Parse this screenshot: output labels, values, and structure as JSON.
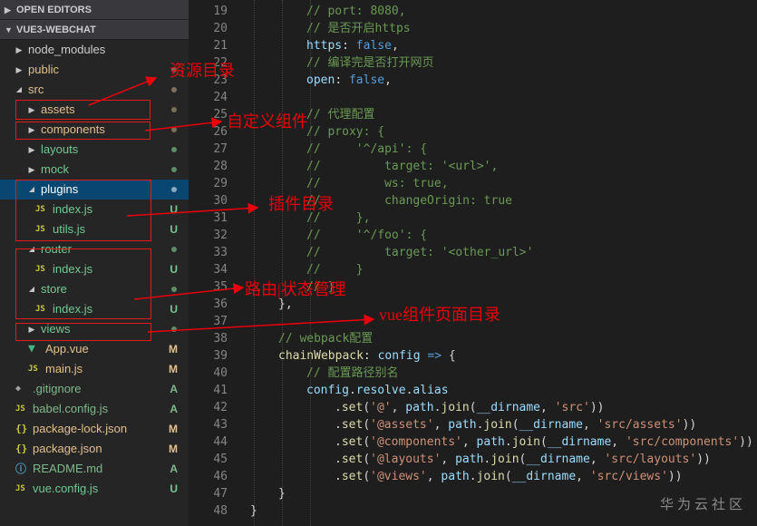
{
  "explorer": {
    "sections": {
      "open_editors": "OPEN EDITORS",
      "project": "VUE3-WEBCHAT"
    },
    "items": [
      {
        "label": "node_modules",
        "type": "folder",
        "state": "collapsed",
        "depth": 0,
        "badge": "",
        "label_color": "#cccccc"
      },
      {
        "label": "public",
        "type": "folder",
        "state": "collapsed",
        "depth": 0,
        "badge": "dot-mod",
        "label_color": "#e2c08d"
      },
      {
        "label": "src",
        "type": "folder",
        "state": "expanded",
        "depth": 0,
        "badge": "dot-mod",
        "label_color": "#e2c08d"
      },
      {
        "label": "assets",
        "type": "folder",
        "state": "collapsed",
        "depth": 1,
        "badge": "dot-mod",
        "label_color": "#e2c08d"
      },
      {
        "label": "components",
        "type": "folder",
        "state": "collapsed",
        "depth": 1,
        "badge": "dot-mod",
        "label_color": "#e2c08d"
      },
      {
        "label": "layouts",
        "type": "folder",
        "state": "collapsed",
        "depth": 1,
        "badge": "dot-unt",
        "label_color": "#73c991"
      },
      {
        "label": "mock",
        "type": "folder",
        "state": "collapsed",
        "depth": 1,
        "badge": "dot-unt",
        "label_color": "#73c991"
      },
      {
        "label": "plugins",
        "type": "folder",
        "state": "expanded",
        "depth": 1,
        "badge": "dot-sel",
        "label_color": "#ffffff",
        "selected": true
      },
      {
        "label": "index.js",
        "type": "js",
        "icon": "JS",
        "depth": 2,
        "badge": "U",
        "label_color": "#73c991"
      },
      {
        "label": "utils.js",
        "type": "js",
        "icon": "JS",
        "depth": 2,
        "badge": "U",
        "label_color": "#73c991"
      },
      {
        "label": "router",
        "type": "folder",
        "state": "expanded",
        "depth": 1,
        "badge": "dot-unt",
        "label_color": "#73c991"
      },
      {
        "label": "index.js",
        "type": "js",
        "icon": "JS",
        "depth": 2,
        "badge": "U",
        "label_color": "#73c991"
      },
      {
        "label": "store",
        "type": "folder",
        "state": "expanded",
        "depth": 1,
        "badge": "dot-unt",
        "label_color": "#73c991"
      },
      {
        "label": "index.js",
        "type": "js",
        "icon": "JS",
        "depth": 2,
        "badge": "U",
        "label_color": "#73c991"
      },
      {
        "label": "views",
        "type": "folder",
        "state": "collapsed",
        "depth": 1,
        "badge": "dot-unt",
        "label_color": "#73c991"
      },
      {
        "label": "App.vue",
        "type": "vue",
        "icon": "V",
        "depth": 1,
        "badge": "M",
        "label_color": "#e2c08d"
      },
      {
        "label": "main.js",
        "type": "js",
        "icon": "JS",
        "depth": 1,
        "badge": "M",
        "label_color": "#e2c08d"
      },
      {
        "label": ".gitignore",
        "type": "git",
        "icon": "◆",
        "depth": 0,
        "badge": "A",
        "label_color": "#81b88b"
      },
      {
        "label": "babel.config.js",
        "type": "js",
        "icon": "JS",
        "depth": 0,
        "badge": "A",
        "label_color": "#81b88b"
      },
      {
        "label": "package-lock.json",
        "type": "json",
        "icon": "{}",
        "depth": 0,
        "badge": "M",
        "label_color": "#e2c08d"
      },
      {
        "label": "package.json",
        "type": "json",
        "icon": "{}",
        "depth": 0,
        "badge": "M",
        "label_color": "#e2c08d"
      },
      {
        "label": "README.md",
        "type": "info",
        "icon": "ⓘ",
        "depth": 0,
        "badge": "A",
        "label_color": "#81b88b"
      },
      {
        "label": "vue.config.js",
        "type": "js",
        "icon": "JS",
        "depth": 0,
        "badge": "U",
        "label_color": "#73c991"
      }
    ]
  },
  "editor": {
    "lines": [
      {
        "n": "19",
        "tokens": [
          [
            "com",
            "// port: 8080,"
          ]
        ],
        "indent": 2
      },
      {
        "n": "20",
        "tokens": [
          [
            "com",
            "// 是否开启https"
          ]
        ],
        "indent": 2
      },
      {
        "n": "21",
        "tokens": [
          [
            "prop",
            "https"
          ],
          [
            "punc",
            ": "
          ],
          [
            "kw",
            "false"
          ],
          [
            "punc",
            ","
          ]
        ],
        "indent": 2
      },
      {
        "n": "22",
        "tokens": [
          [
            "com",
            "// 编译完是否打开网页"
          ]
        ],
        "indent": 2
      },
      {
        "n": "23",
        "tokens": [
          [
            "prop",
            "open"
          ],
          [
            "punc",
            ": "
          ],
          [
            "kw",
            "false"
          ],
          [
            "punc",
            ","
          ]
        ],
        "indent": 2
      },
      {
        "n": "24",
        "tokens": [],
        "indent": 0
      },
      {
        "n": "25",
        "tokens": [
          [
            "com",
            "// 代理配置"
          ]
        ],
        "indent": 2
      },
      {
        "n": "26",
        "tokens": [
          [
            "com",
            "// proxy: {"
          ]
        ],
        "indent": 2
      },
      {
        "n": "27",
        "tokens": [
          [
            "com",
            "//     '^/api': {"
          ]
        ],
        "indent": 2
      },
      {
        "n": "28",
        "tokens": [
          [
            "com",
            "//         target: '<url>',"
          ]
        ],
        "indent": 2
      },
      {
        "n": "29",
        "tokens": [
          [
            "com",
            "//         ws: true,"
          ]
        ],
        "indent": 2
      },
      {
        "n": "30",
        "tokens": [
          [
            "com",
            "//         changeOrigin: true"
          ]
        ],
        "indent": 2
      },
      {
        "n": "31",
        "tokens": [
          [
            "com",
            "//     },"
          ]
        ],
        "indent": 2
      },
      {
        "n": "32",
        "tokens": [
          [
            "com",
            "//     '^/foo': {"
          ]
        ],
        "indent": 2
      },
      {
        "n": "33",
        "tokens": [
          [
            "com",
            "//         target: '<other_url>'"
          ]
        ],
        "indent": 2
      },
      {
        "n": "34",
        "tokens": [
          [
            "com",
            "//     }"
          ]
        ],
        "indent": 2
      },
      {
        "n": "35",
        "tokens": [
          [
            "com",
            "// }"
          ]
        ],
        "indent": 2
      },
      {
        "n": "36",
        "tokens": [
          [
            "punc",
            "},"
          ]
        ],
        "indent": 1
      },
      {
        "n": "37",
        "tokens": [],
        "indent": 0
      },
      {
        "n": "38",
        "tokens": [
          [
            "com",
            "// webpack配置"
          ]
        ],
        "indent": 1
      },
      {
        "n": "39",
        "tokens": [
          [
            "fn",
            "chainWebpack"
          ],
          [
            "punc",
            ": "
          ],
          [
            "prop",
            "config"
          ],
          [
            "punc",
            " "
          ],
          [
            "kw",
            "=>"
          ],
          [
            "punc",
            " {"
          ]
        ],
        "indent": 1
      },
      {
        "n": "40",
        "tokens": [
          [
            "com",
            "// 配置路径别名"
          ]
        ],
        "indent": 2
      },
      {
        "n": "41",
        "tokens": [
          [
            "prop",
            "config"
          ],
          [
            "punc",
            "."
          ],
          [
            "prop",
            "resolve"
          ],
          [
            "punc",
            "."
          ],
          [
            "prop",
            "alias"
          ]
        ],
        "indent": 2
      },
      {
        "n": "42",
        "tokens": [
          [
            "punc",
            "."
          ],
          [
            "fn",
            "set"
          ],
          [
            "punc",
            "("
          ],
          [
            "str",
            "'@'"
          ],
          [
            "punc",
            ", "
          ],
          [
            "prop",
            "path"
          ],
          [
            "punc",
            "."
          ],
          [
            "fn",
            "join"
          ],
          [
            "punc",
            "("
          ],
          [
            "prop",
            "__dirname"
          ],
          [
            "punc",
            ", "
          ],
          [
            "str",
            "'src'"
          ],
          [
            "punc",
            "))"
          ]
        ],
        "indent": 3
      },
      {
        "n": "43",
        "tokens": [
          [
            "punc",
            "."
          ],
          [
            "fn",
            "set"
          ],
          [
            "punc",
            "("
          ],
          [
            "str",
            "'@assets'"
          ],
          [
            "punc",
            ", "
          ],
          [
            "prop",
            "path"
          ],
          [
            "punc",
            "."
          ],
          [
            "fn",
            "join"
          ],
          [
            "punc",
            "("
          ],
          [
            "prop",
            "__dirname"
          ],
          [
            "punc",
            ", "
          ],
          [
            "str",
            "'src/assets'"
          ],
          [
            "punc",
            "))"
          ]
        ],
        "indent": 3
      },
      {
        "n": "44",
        "tokens": [
          [
            "punc",
            "."
          ],
          [
            "fn",
            "set"
          ],
          [
            "punc",
            "("
          ],
          [
            "str",
            "'@components'"
          ],
          [
            "punc",
            ", "
          ],
          [
            "prop",
            "path"
          ],
          [
            "punc",
            "."
          ],
          [
            "fn",
            "join"
          ],
          [
            "punc",
            "("
          ],
          [
            "prop",
            "__dirname"
          ],
          [
            "punc",
            ", "
          ],
          [
            "str",
            "'src/components'"
          ],
          [
            "punc",
            "))"
          ]
        ],
        "indent": 3
      },
      {
        "n": "45",
        "tokens": [
          [
            "punc",
            "."
          ],
          [
            "fn",
            "set"
          ],
          [
            "punc",
            "("
          ],
          [
            "str",
            "'@layouts'"
          ],
          [
            "punc",
            ", "
          ],
          [
            "prop",
            "path"
          ],
          [
            "punc",
            "."
          ],
          [
            "fn",
            "join"
          ],
          [
            "punc",
            "("
          ],
          [
            "prop",
            "__dirname"
          ],
          [
            "punc",
            ", "
          ],
          [
            "str",
            "'src/layouts'"
          ],
          [
            "punc",
            "))"
          ]
        ],
        "indent": 3
      },
      {
        "n": "46",
        "tokens": [
          [
            "punc",
            "."
          ],
          [
            "fn",
            "set"
          ],
          [
            "punc",
            "("
          ],
          [
            "str",
            "'@views'"
          ],
          [
            "punc",
            ", "
          ],
          [
            "prop",
            "path"
          ],
          [
            "punc",
            "."
          ],
          [
            "fn",
            "join"
          ],
          [
            "punc",
            "("
          ],
          [
            "prop",
            "__dirname"
          ],
          [
            "punc",
            ", "
          ],
          [
            "str",
            "'src/views'"
          ],
          [
            "punc",
            "))"
          ]
        ],
        "indent": 3
      },
      {
        "n": "47",
        "tokens": [
          [
            "punc",
            "}"
          ]
        ],
        "indent": 1
      },
      {
        "n": "48",
        "tokens": [
          [
            "punc",
            "}"
          ]
        ],
        "indent": 0
      }
    ]
  },
  "annotations": {
    "assets_note": "资源目录",
    "components_note": "自定义组件",
    "plugins_note": "插件目录",
    "router_store_note": "路由|状态管理",
    "views_note": "vue组件页面目录"
  },
  "watermark": "华为云社区",
  "colors": {
    "annotation": "#e8000b",
    "selection": "#094771",
    "modified": "#e2c08d",
    "added": "#81b88b",
    "untracked": "#73c991"
  }
}
